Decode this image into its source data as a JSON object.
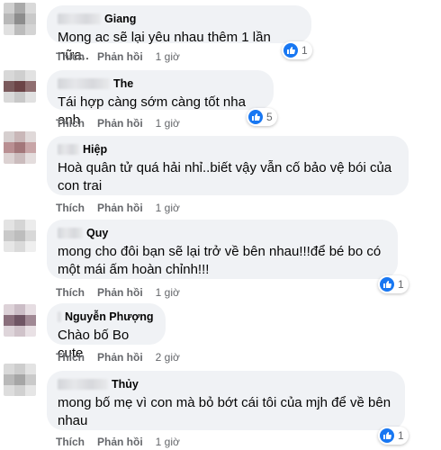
{
  "actions": {
    "like": "Thích",
    "reply": "Phản hồi"
  },
  "colors": {
    "bubble": "#f0f2f5",
    "like_blue": "#1877f2",
    "meta_gray": "#65676b"
  },
  "comments": [
    {
      "name": "Giang",
      "lines": [
        "Mong ac sẽ lại yêu nhau thêm 1 lần nữa.."
      ],
      "time": "1 giờ",
      "reactions": "1"
    },
    {
      "name": "The",
      "lines": [
        "Tái hợp càng sớm càng tốt nha anh"
      ],
      "time": "1 giờ",
      "reactions": "5"
    },
    {
      "name": "Hiệp",
      "lines": [
        "Hoà quân tử quá hải nhỉ..biết vậy vẫn cố bảo vệ bói của",
        "con trai"
      ],
      "time": "1 giờ",
      "reactions": ""
    },
    {
      "name": "Quy",
      "lines": [
        "mong cho đôi bạn sẽ lại trở về bên nhau!!!để bé bo có",
        "một mái ấm hoàn chỉnh!!!"
      ],
      "time": "1 giờ",
      "reactions": "1"
    },
    {
      "name": "Nguyễn Phượng",
      "lines": [
        "Chào bố Bo cute"
      ],
      "time": "2 giờ",
      "reactions": ""
    },
    {
      "name": "Thủy",
      "lines": [
        "mong bố mẹ vì con mà bỏ bớt cái tôi của mjh để về bên",
        "nhau"
      ],
      "time": "1 giờ",
      "reactions": "1"
    }
  ]
}
